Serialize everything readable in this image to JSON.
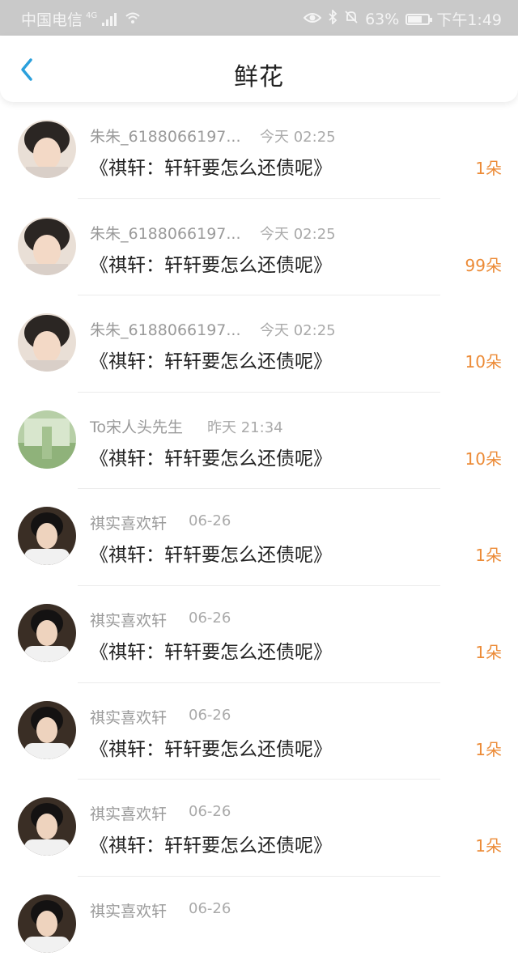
{
  "statusbar": {
    "carrier": "中国电信",
    "network": "4G",
    "battery": "63%",
    "time": "下午1:49",
    "icons": [
      "eye-icon",
      "bluetooth-icon",
      "mute-bell-icon",
      "battery-icon"
    ]
  },
  "header": {
    "title": "鲜花",
    "back_icon": "chevron-left-icon"
  },
  "colors": {
    "accent": "#ec8b37",
    "back": "#2ba0dc"
  },
  "items": [
    {
      "name": "朱朱_6188066197...",
      "time": "今天 02:25",
      "message": "《祺轩：轩轩要怎么还债呢》",
      "count": "1朵"
    },
    {
      "name": "朱朱_6188066197...",
      "time": "今天 02:25",
      "message": "《祺轩：轩轩要怎么还债呢》",
      "count": "99朵"
    },
    {
      "name": "朱朱_6188066197...",
      "time": "今天 02:25",
      "message": "《祺轩：轩轩要怎么还债呢》",
      "count": "10朵"
    },
    {
      "name": "To宋人头先生",
      "time": "昨天 21:34",
      "message": "《祺轩：轩轩要怎么还债呢》",
      "count": "10朵"
    },
    {
      "name": "祺实喜欢轩",
      "time": "06-26",
      "message": "《祺轩：轩轩要怎么还债呢》",
      "count": "1朵"
    },
    {
      "name": "祺实喜欢轩",
      "time": "06-26",
      "message": "《祺轩：轩轩要怎么还债呢》",
      "count": "1朵"
    },
    {
      "name": "祺实喜欢轩",
      "time": "06-26",
      "message": "《祺轩：轩轩要怎么还债呢》",
      "count": "1朵"
    },
    {
      "name": "祺实喜欢轩",
      "time": "06-26",
      "message": "《祺轩：轩轩要怎么还债呢》",
      "count": "1朵"
    },
    {
      "name": "祺实喜欢轩",
      "time": "06-26",
      "message": "",
      "count": ""
    }
  ]
}
